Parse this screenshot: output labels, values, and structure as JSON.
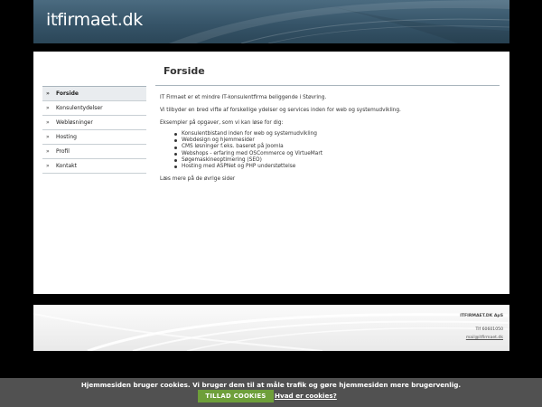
{
  "header": {
    "logo_text": "itfirmaet.dk"
  },
  "page": {
    "title": "Forside"
  },
  "sidebar": {
    "items": [
      {
        "label": "Forside",
        "active": true
      },
      {
        "label": "Konsulentydelser",
        "active": false
      },
      {
        "label": "Webløsninger",
        "active": false
      },
      {
        "label": "Hosting",
        "active": false
      },
      {
        "label": "Profil",
        "active": false
      },
      {
        "label": "Kontakt",
        "active": false
      }
    ],
    "bullet_icon": "bullet-icon"
  },
  "main": {
    "intro": "IT Firmaet er et mindre IT-konsulentfirma beliggende i Støvring.",
    "services": "Vi tilbyder en bred vifte af forskellige ydelser og services inden for web og systemudvikling.",
    "examples_heading": "Eksempler på opgaver, som vi kan løse for dig:",
    "examples": [
      "Konsulentbistand inden for web og systemudvikling",
      "Webdesign og hjemmesider",
      "CMS løsninger f.eks. baseret på Joomla",
      "Webshops - erfaring med OSCommerce og VirtueMart",
      "Søgemaskineoptimering (SEO)",
      "Hosting med ASPNet og PHP understøttelse"
    ],
    "read_more": "Læs mere på de øvrige sider"
  },
  "footer": {
    "company": "ITFIRMAET.DK ApS",
    "phone": "Tlf 60601050",
    "email": "mail@itfirmaet.dk"
  },
  "cookie": {
    "message": "Hjemmesiden bruger cookies. Vi bruger dem til at måle trafik og gøre hjemmesiden mere brugervenlig.",
    "accept_label": "TILLAD COOKIES",
    "info_link": "Hvad er cookies?"
  },
  "colors": {
    "header_bg": "#365468",
    "accent_green": "#6e9f3a",
    "cookie_bg": "#555555"
  }
}
